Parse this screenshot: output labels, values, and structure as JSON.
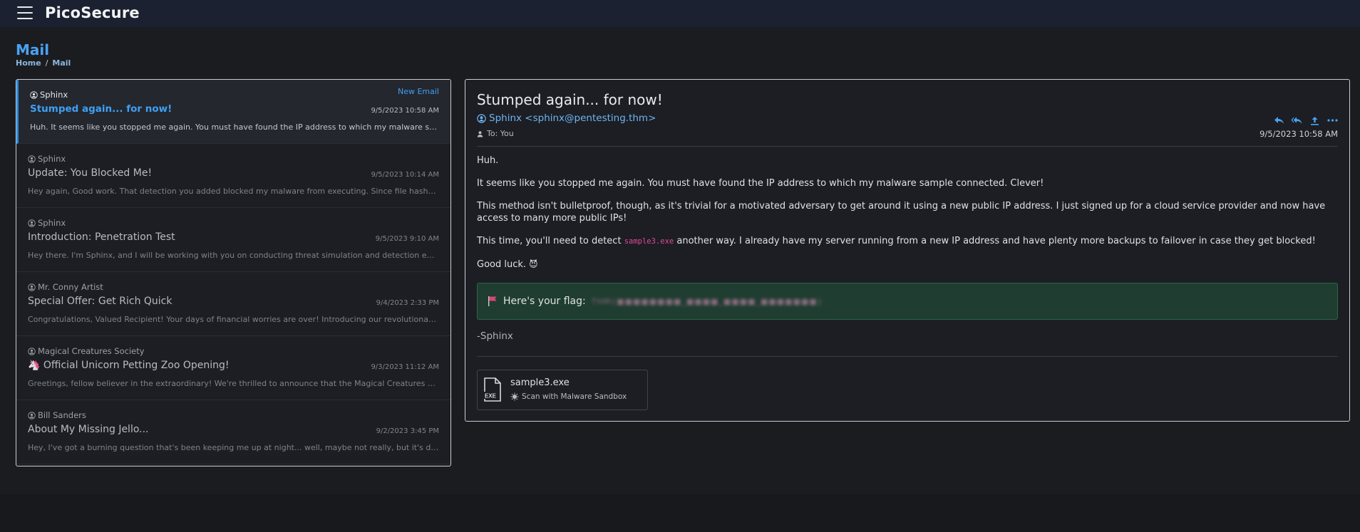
{
  "app": {
    "brand": "PicoSecure"
  },
  "page": {
    "title": "Mail",
    "breadcrumb": [
      "Home",
      "Mail"
    ]
  },
  "mail_list": {
    "new_email_label": "New Email",
    "items": [
      {
        "sender": "Sphinx",
        "subject": "Stumped again... for now!",
        "date": "9/5/2023 10:58 AM",
        "preview": "Huh. It seems like you stopped me again. You must have found the IP address to which my malware sample connected. Clever!",
        "active": true
      },
      {
        "sender": "Sphinx",
        "subject": "Update: You Blocked Me!",
        "date": "9/5/2023 10:14 AM",
        "preview": "Hey again, Good work. That detection you added blocked my malware from executing. Since file hashes and signatures are easy to change...",
        "active": false
      },
      {
        "sender": "Sphinx",
        "subject": "Introduction: Penetration Test",
        "date": "9/5/2023 9:10 AM",
        "preview": "Hey there. I'm Sphinx, and I will be working with you on conducting threat simulation and detection engineering exercises...",
        "active": false
      },
      {
        "sender": "Mr. Conny Artist",
        "subject": "Special Offer: Get Rich Quick",
        "date": "9/4/2023 2:33 PM",
        "preview": "Congratulations, Valued Recipient! Your days of financial worries are over! Introducing our revolutionary program that will...",
        "active": false
      },
      {
        "sender": "Magical Creatures Society",
        "subject": "Official Unicorn Petting Zoo Opening!",
        "subject_emoji": "🦄",
        "date": "9/3/2023 11:12 AM",
        "preview": "Greetings, fellow believer in the extraordinary! We're thrilled to announce that the Magical Creatures Society is opening...",
        "active": false
      },
      {
        "sender": "Bill Sanders",
        "subject": "About My Missing Jello...",
        "date": "9/2/2023 3:45 PM",
        "preview": "Hey, I've got a burning question that's been keeping me up at night... well, maybe not really, but it's definitely been on my mind...",
        "active": false
      }
    ]
  },
  "reader": {
    "subject": "Stumped again... for now!",
    "from": "Sphinx <sphinx@pentesting.thm>",
    "to": "To: You",
    "date": "9/5/2023 10:58 AM",
    "body": {
      "p1": "Huh.",
      "p2": "It seems like you stopped me again. You must have found the IP address to which my malware sample connected. Clever!",
      "p3": "This method isn't bulletproof, though, as it's trivial for a motivated adversary to get around it using a new public IP address. I just signed up for a cloud service provider and now have access to many more public IPs!",
      "p4_before": "This time, you'll need to detect ",
      "p4_code": "sample3.exe",
      "p4_after": " another way. I already have my server running from a new IP address and have plenty more backups to failover in case they get blocked!",
      "p5": "Good luck.",
      "p5_emoji": "😈"
    },
    "flag_label": "Here's your flag:",
    "flag_value": "THM{■■■■■■■■_■■■■_■■■■_■■■■■■■}",
    "signature": "-Sphinx",
    "attachment": {
      "name": "sample3.exe",
      "icon_label": "EXE",
      "scan_label": "Scan with Malware Sandbox"
    }
  },
  "colors": {
    "accent": "#3fa0f5",
    "topbar": "#1b2130",
    "flag_bg": "#1f3d30",
    "code": "#e0489a"
  }
}
